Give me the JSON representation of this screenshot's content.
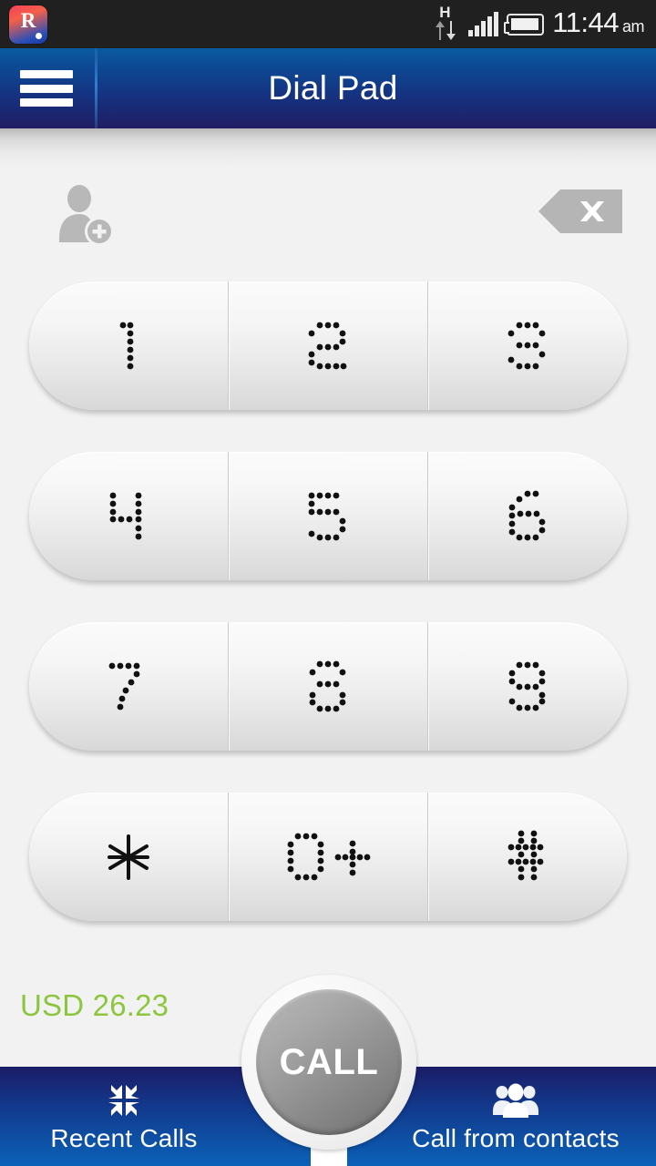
{
  "statusbar": {
    "app_icon_letter": "R",
    "data_indicator": "H",
    "time": "11:44",
    "ampm": "am",
    "icons": [
      "app-icon",
      "data-arrows-icon",
      "signal-icon",
      "battery-icon"
    ]
  },
  "header": {
    "title": "Dial Pad",
    "menu_icon": "hamburger-menu-icon"
  },
  "actions": {
    "add_contact_icon": "add-contact-icon",
    "backspace_icon": "backspace-icon"
  },
  "keypad": {
    "rows": [
      [
        {
          "key": "1"
        },
        {
          "key": "2"
        },
        {
          "key": "3"
        }
      ],
      [
        {
          "key": "4"
        },
        {
          "key": "5"
        },
        {
          "key": "6"
        }
      ],
      [
        {
          "key": "7"
        },
        {
          "key": "8"
        },
        {
          "key": "9"
        }
      ],
      [
        {
          "key": "*"
        },
        {
          "key": "0+"
        },
        {
          "key": "#"
        }
      ]
    ]
  },
  "balance": {
    "text": "USD 26.23",
    "color": "#8cc63e"
  },
  "call_button": {
    "label": "CALL"
  },
  "bottom_nav": [
    {
      "label": "Recent Calls",
      "icon": "four-arrows-icon"
    },
    {
      "label": "Call from contacts",
      "icon": "group-contacts-icon"
    }
  ],
  "colors": {
    "status_bar": "#202020",
    "header_top": "#0a5ba1",
    "header_bottom": "#201d63",
    "background": "#f2f2f2",
    "balance_green": "#8cc63e",
    "nav_bottom": "#0a62b8"
  }
}
